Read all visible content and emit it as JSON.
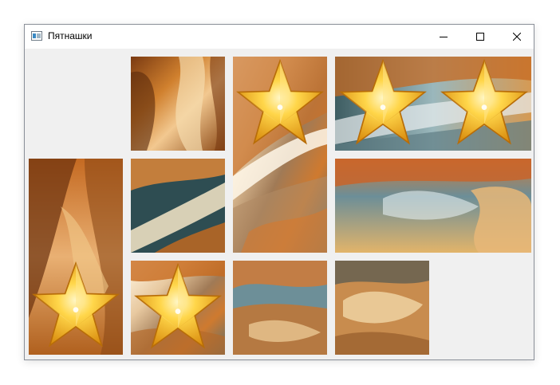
{
  "window": {
    "title": "Пятнашки"
  },
  "icons": {
    "app": "app-icon",
    "minimize": "minimize-icon",
    "maximize": "maximize-icon",
    "close": "close-icon"
  },
  "colors": {
    "star_gold": "#f2b51c",
    "star_light": "#ffe27a",
    "rock_orange": "#c86a1e",
    "rock_dark": "#5a2a0c",
    "sky_blue": "#6a9aa6",
    "board_bg": "#f0f0f0"
  },
  "board": {
    "columns": 5,
    "rows": 3,
    "tiles": [
      {
        "id": "tile-r1c2",
        "star": false
      },
      {
        "id": "tile-r1c3-tall",
        "star": true
      },
      {
        "id": "tile-r1c4-wide",
        "star": true,
        "stars": 2
      },
      {
        "id": "tile-r2c1-tall",
        "star": true
      },
      {
        "id": "tile-r2c2",
        "star": false
      },
      {
        "id": "tile-r2c4-wide",
        "star": false
      },
      {
        "id": "tile-r3c2",
        "star": true
      },
      {
        "id": "tile-r3c3",
        "star": false
      },
      {
        "id": "tile-r3c4",
        "star": false
      }
    ],
    "empty_cells": [
      "r1c1",
      "r3c5"
    ]
  }
}
